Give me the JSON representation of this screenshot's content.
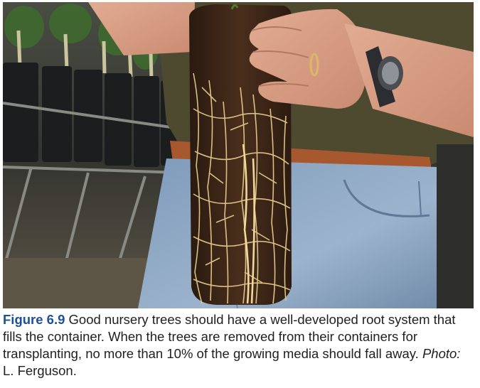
{
  "photo": {
    "subject": "nursery tree root ball held in hand"
  },
  "caption": {
    "figure_label": "Figure 6.9",
    "text": " Good nursery trees should have a well-developed root system that fills the container. When the trees are removed from their containers for transplanting, no more than 10% of the growing media should fall away. ",
    "photo_prefix": "Photo:",
    "photo_credit": " L. Ferguson."
  },
  "colors": {
    "figure_label": "#1e4f9a",
    "soil": "#3b2416",
    "roots": "#e2c98a",
    "shirt": "#4d4a30",
    "jeans": "#8fa9c4"
  }
}
